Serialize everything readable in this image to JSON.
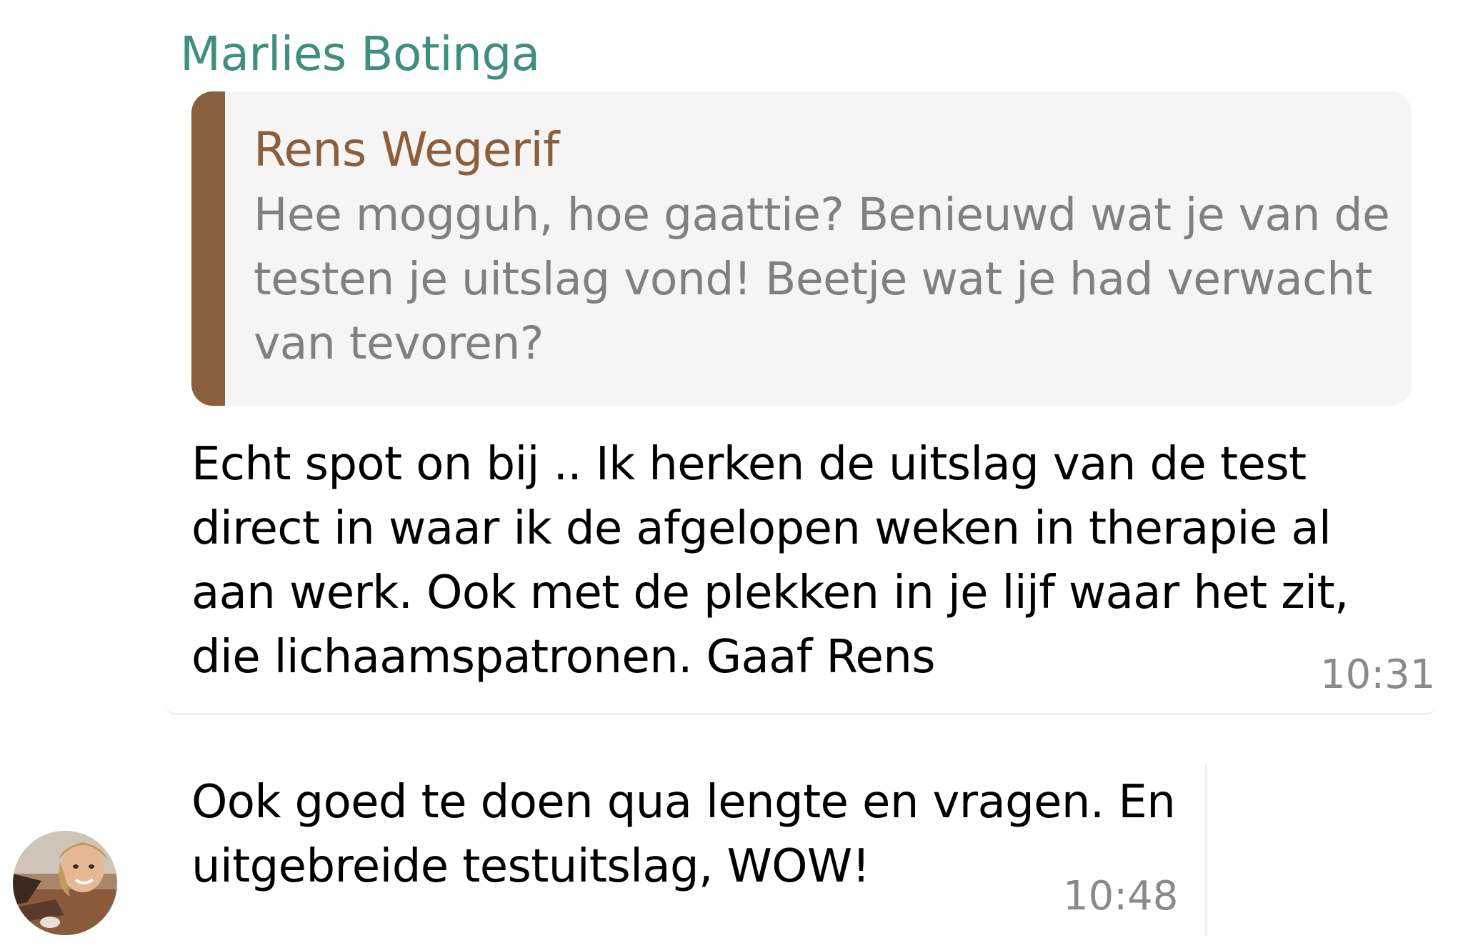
{
  "messages": [
    {
      "sender": "Marlies Botinga",
      "quote": {
        "author": "Rens Wegerif",
        "text": "Hee mogguh, hoe gaattie? Benieuwd wat je van de testen je uitslag vond! Beetje wat je had verwacht van tevoren?"
      },
      "text": "Echt spot on bij .. Ik herken de uitslag van de test direct in waar ik de afgelopen weken in therapie al aan werk. Ook met de plekken in je lijf waar het zit, die lichaamspatronen. Gaaf Rens",
      "time": "10:31"
    },
    {
      "text": "Ook goed te doen qua lengte en vragen. En uitgebreide testuitslag, WOW!",
      "time": "10:48"
    }
  ],
  "colors": {
    "sender_name": "#3f8f7f",
    "quote_accent": "#8b5e3c",
    "quote_background": "#f5f5f5",
    "quote_text": "#808080",
    "timestamp": "#8a8a8a"
  },
  "icons": {
    "avatar": "sender-avatar-photo"
  }
}
